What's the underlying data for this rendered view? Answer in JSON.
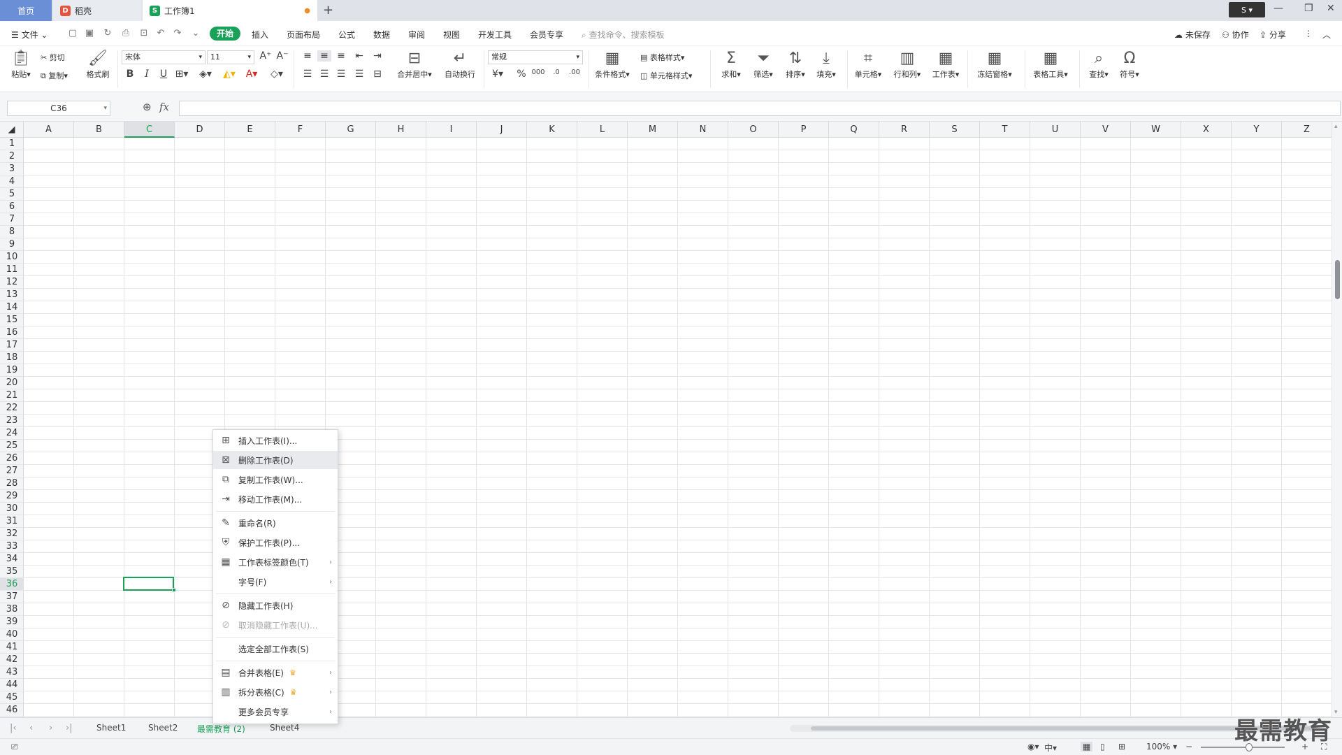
{
  "tabs": {
    "home": "首页",
    "shell": "稻壳",
    "workbook": "工作簿1"
  },
  "menu": {
    "file": "文件",
    "items": [
      "开始",
      "插入",
      "页面布局",
      "公式",
      "数据",
      "审阅",
      "视图",
      "开发工具",
      "会员专享"
    ],
    "search_placeholder": "查找命令、搜索模板",
    "right": {
      "unsaved": "未保存",
      "collab": "协作",
      "share": "分享"
    }
  },
  "ribbon": {
    "paste": "粘贴",
    "cut": "剪切",
    "copy": "复制",
    "format_painter": "格式刷",
    "font": "宋体",
    "size": "11",
    "merge": "合并居中",
    "wrap": "自动换行",
    "number_format": "常规",
    "cond_format": "条件格式",
    "table_style": "表格样式",
    "cell_style": "单元格样式",
    "sum": "求和",
    "filter": "筛选",
    "sort": "排序",
    "fill": "填充",
    "cell": "单元格",
    "rowcol": "行和列",
    "sheet": "工作表",
    "freeze": "冻结窗格",
    "table_tools": "表格工具",
    "find": "查找",
    "symbol": "符号"
  },
  "formula_bar": {
    "name_box": "C36",
    "fx": "fx"
  },
  "columns": [
    "A",
    "B",
    "C",
    "D",
    "E",
    "F",
    "G",
    "H",
    "I",
    "J",
    "K",
    "L",
    "M",
    "N",
    "O",
    "P",
    "Q",
    "R",
    "S",
    "T",
    "U",
    "V",
    "W",
    "X",
    "Y",
    "Z"
  ],
  "active_column": "C",
  "active_row": 36,
  "row_count": 46,
  "sheets": [
    "Sheet1",
    "Sheet2",
    "最需教育 (2)",
    "Sheet4"
  ],
  "active_sheet": "最需教育 (2)",
  "context_menu": [
    {
      "label": "插入工作表(I)...",
      "icon": "insert-sheet-icon",
      "glyph": "⊞"
    },
    {
      "label": "删除工作表(D)",
      "icon": "delete-sheet-icon",
      "glyph": "⊠",
      "hover": true
    },
    {
      "label": "复制工作表(W)...",
      "icon": "copy-sheet-icon",
      "glyph": "⧉"
    },
    {
      "label": "移动工作表(M)...",
      "icon": "move-sheet-icon",
      "glyph": "⇥"
    },
    {
      "sep": true
    },
    {
      "label": "重命名(R)",
      "icon": "rename-icon",
      "glyph": "✎"
    },
    {
      "label": "保护工作表(P)...",
      "icon": "protect-sheet-icon",
      "glyph": "⛨"
    },
    {
      "label": "工作表标签颜色(T)",
      "icon": "tab-color-icon",
      "glyph": "▦",
      "submenu": true
    },
    {
      "label": "字号(F)",
      "icon": "",
      "glyph": "",
      "submenu": true
    },
    {
      "sep": true
    },
    {
      "label": "隐藏工作表(H)",
      "icon": "hide-sheet-icon",
      "glyph": "⊘"
    },
    {
      "label": "取消隐藏工作表(U)...",
      "icon": "unhide-sheet-icon",
      "glyph": "⊘",
      "disabled": true
    },
    {
      "sep": true
    },
    {
      "label": "选定全部工作表(S)",
      "icon": "",
      "glyph": ""
    },
    {
      "sep": true
    },
    {
      "label": "合并表格(E)",
      "icon": "merge-tables-icon",
      "glyph": "▤",
      "submenu": true,
      "crown": true
    },
    {
      "label": "拆分表格(C)",
      "icon": "split-table-icon",
      "glyph": "▥",
      "submenu": true,
      "crown": true
    },
    {
      "label": "更多会员专享",
      "icon": "",
      "glyph": "",
      "submenu": true
    }
  ],
  "status": {
    "zoom": "100%"
  },
  "watermark": "最需教育",
  "colors": {
    "accent": "#1aa158",
    "home_tab": "#6b8fd6"
  }
}
